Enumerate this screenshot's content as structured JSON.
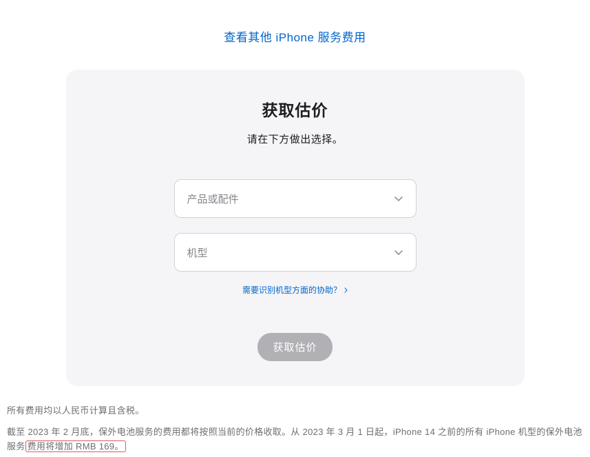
{
  "topLink": {
    "label": "查看其他 iPhone 服务费用"
  },
  "card": {
    "title": "获取估价",
    "subtitle": "请在下方做出选择。",
    "select1": {
      "placeholder": "产品或配件"
    },
    "select2": {
      "placeholder": "机型"
    },
    "helpLink": "需要识别机型方面的协助？",
    "submitButton": "获取估价"
  },
  "footer": {
    "line1": "所有费用均以人民币计算且含税。",
    "line2_part1": "截至 2023 年 2 月底，保外电池服务的费用都将按照当前的价格收取。从 2023 年 3 月 1 日起，iPhone 14 之前的所有 iPhone 机型的保外电池服务",
    "line2_highlight": "费用将增加 RMB 169。"
  }
}
